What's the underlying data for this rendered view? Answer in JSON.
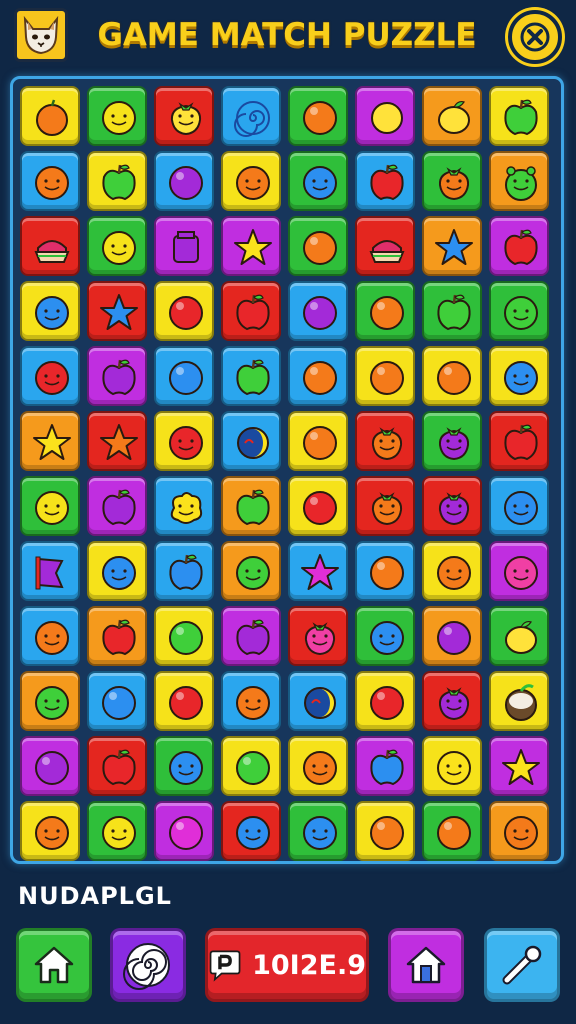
{
  "header": {
    "title": "GAME MATCH PUZZLE",
    "avatar_icon": "cat-face-icon",
    "close_icon": "close-icon"
  },
  "board": {
    "rows": 12,
    "cols": 8,
    "tiles": [
      [
        "yellow:orange-fruit",
        "green:smiley",
        "red:berry",
        "blue:swirl",
        "green:orange-ball",
        "magenta:grape",
        "orange:lemon",
        "yellow:green-apple"
      ],
      [
        "blue:orange-smiley",
        "yellow:green-apple",
        "blue:purple-ball",
        "yellow:orange-smiley",
        "green:blue-smiley",
        "blue:red-apple",
        "green:orange-berry",
        "orange:green-monster"
      ],
      [
        "red:cake",
        "green:smiley",
        "magenta:purple-jar",
        "magenta:yellow-star",
        "green:orange-ball",
        "red:cake",
        "orange:blue-star",
        "magenta:red-apple"
      ],
      [
        "yellow:blue-smiley",
        "red:blue-star",
        "yellow:red-ball",
        "red:red-apple",
        "blue:purple-ball",
        "green:orange-ball",
        "green:green-apple",
        "green:green-smiley"
      ],
      [
        "blue:red-smiley",
        "magenta:purple-apple",
        "blue:blue-ball",
        "blue:green-apple",
        "blue:orange-ball",
        "yellow:orange-ball",
        "yellow:orange-ball",
        "yellow:blue-smiley"
      ],
      [
        "orange:yellow-star",
        "red:orange-star",
        "yellow:red-smiley",
        "blue:moon",
        "yellow:orange-ball",
        "red:orange-berry",
        "green:purple-berry",
        "red:red-apple"
      ],
      [
        "green:smiley",
        "magenta:purple-apple",
        "blue:yellow-blob",
        "orange:green-apple",
        "yellow:red-ball",
        "red:orange-berry",
        "red:purple-berry",
        "blue:blue-smiley"
      ],
      [
        "blue:purple-flag",
        "yellow:blue-smiley",
        "blue:blue-apple",
        "orange:green-smiley",
        "blue:magenta-star",
        "blue:orange-ball",
        "yellow:orange-smiley",
        "magenta:pink-smiley"
      ],
      [
        "blue:orange-smiley",
        "orange:red-apple",
        "yellow:green-ball",
        "magenta:purple-apple",
        "red:pink-berry",
        "green:blue-smiley",
        "orange:purple-ball",
        "green:lemon"
      ],
      [
        "orange:green-smiley",
        "blue:blue-ball",
        "yellow:red-ball",
        "blue:orange-smiley",
        "blue:moon",
        "yellow:red-ball",
        "red:purple-berry",
        "yellow:coconut"
      ],
      [
        "magenta:purple-ball",
        "red:red-apple",
        "green:blue-smiley",
        "yellow:green-ball",
        "yellow:orange-smiley",
        "magenta:blue-apple",
        "yellow:yellow-smiley",
        "magenta:yellow-star"
      ],
      [
        "yellow:orange-smiley",
        "green:smiley",
        "magenta:magenta-ball",
        "red:blue-smiley",
        "green:blue-smiley",
        "yellow:orange-ball",
        "green:orange-ball",
        "orange:orange-smiley"
      ]
    ]
  },
  "status": {
    "text": "NUDAPLGL"
  },
  "toolbar": {
    "home_icon": "home-icon",
    "spiral_icon": "spiral-icon",
    "score_icon": "speech-bubble-icon",
    "score_value": "10I2E.9",
    "house_icon": "house-icon",
    "wand_icon": "magic-wand-icon"
  },
  "colors": {
    "background": "#0f2745",
    "title": "#f9cf1b",
    "board_border": "#3ea6e6",
    "tile_yellow": "#f6e21a",
    "tile_green": "#2fbf3a",
    "tile_red": "#e4261f",
    "tile_blue": "#2aa6ee",
    "tile_magenta": "#c02ee0",
    "tile_orange": "#f59a1c"
  }
}
